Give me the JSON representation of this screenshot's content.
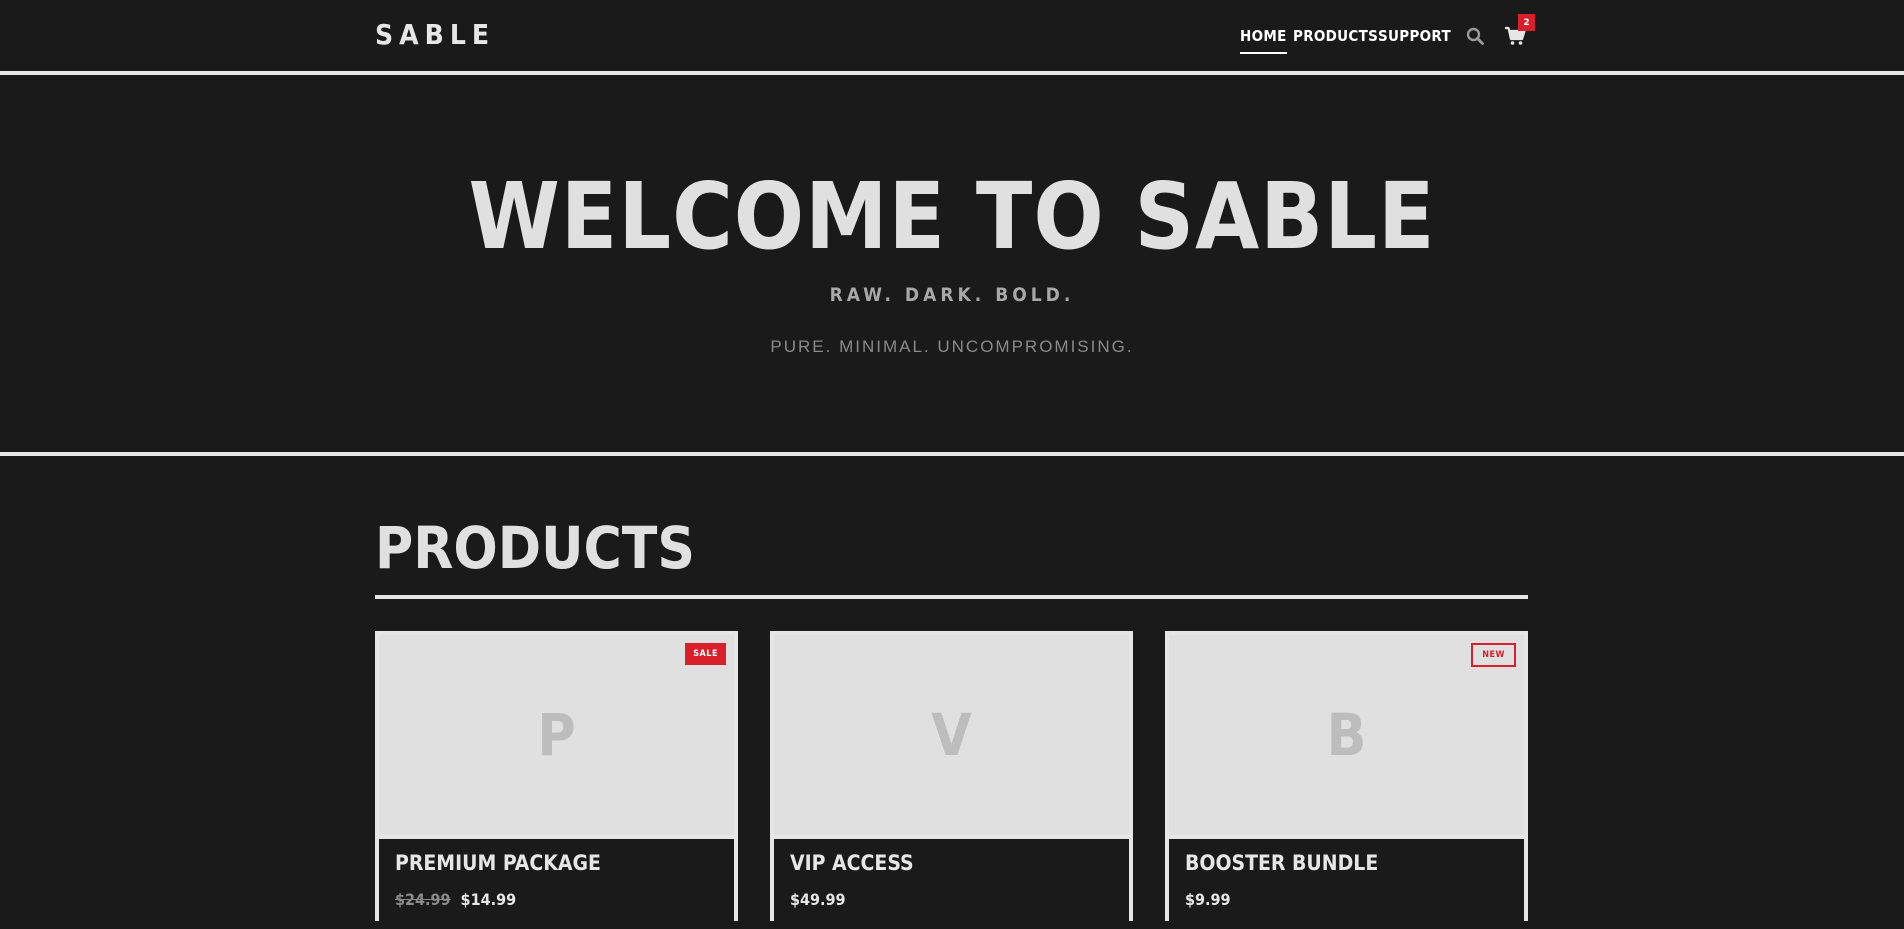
{
  "header": {
    "logo": "SABLE",
    "nav": [
      {
        "label": "HOME",
        "active": true
      },
      {
        "label": "PRODUCTS",
        "active": false
      },
      {
        "label": "SUPPORT",
        "active": false
      }
    ],
    "search_icon": "search-icon",
    "cart_icon": "cart-icon",
    "cart_count": "2"
  },
  "hero": {
    "title": "WELCOME TO SABLE",
    "subtitle": "RAW. DARK. BOLD.",
    "tagline": "PURE. MINIMAL. UNCOMPROMISING."
  },
  "products": {
    "title": "PRODUCTS",
    "items": [
      {
        "initial": "P",
        "name": "PREMIUM PACKAGE",
        "old_price": "$24.99",
        "price": "$14.99",
        "badge": "SALE"
      },
      {
        "initial": "V",
        "name": "VIP ACCESS",
        "old_price": "",
        "price": "$49.99",
        "badge": ""
      },
      {
        "initial": "B",
        "name": "BOOSTER BUNDLE",
        "old_price": "",
        "price": "$9.99",
        "badge": "NEW"
      }
    ]
  },
  "colors": {
    "background": "#1a1a1a",
    "text": "#e0e0e0",
    "accent": "#d9202a"
  }
}
